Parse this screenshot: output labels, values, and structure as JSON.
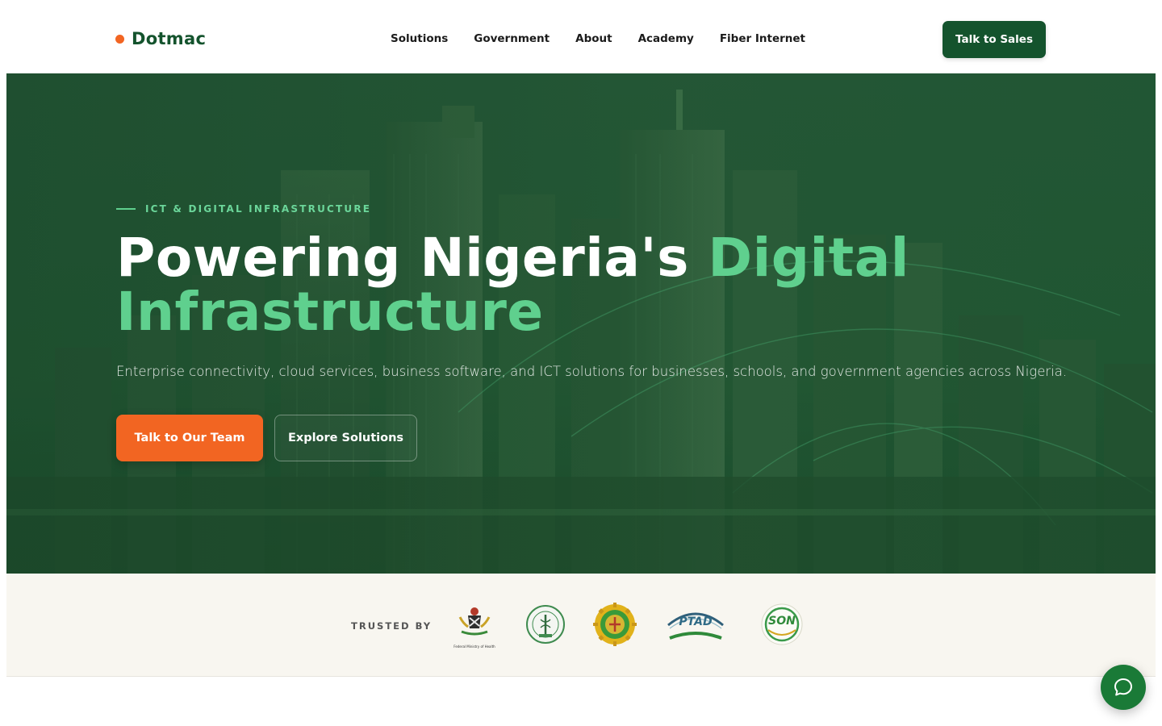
{
  "brand": {
    "name": "Dotmac",
    "dot_color": "#f26522",
    "primary_color": "#14532d"
  },
  "nav": {
    "items": [
      {
        "label": "Solutions"
      },
      {
        "label": "Government"
      },
      {
        "label": "About"
      },
      {
        "label": "Academy"
      },
      {
        "label": "Fiber Internet"
      }
    ],
    "cta_label": "Talk to Sales"
  },
  "hero": {
    "eyebrow": "ICT & DIGITAL INFRASTRUCTURE",
    "headline_part1": "Powering Nigeria's ",
    "headline_accent1": "Digital",
    "headline_accent2": "Infrastructure",
    "subtext": "Enterprise connectivity, cloud services, business software, and ICT solutions for businesses, schools, and government agencies across Nigeria.",
    "primary_button": "Talk to Our Team",
    "secondary_button": "Explore Solutions",
    "accent_color": "#5fd08e"
  },
  "trusted": {
    "label": "TRUSTED BY",
    "logos": [
      {
        "name": "coat-of-arms-logo",
        "caption": "Federal Ministry of Health"
      },
      {
        "name": "medical-council-seal-logo"
      },
      {
        "name": "gear-emblem-logo"
      },
      {
        "name": "ptad-logo",
        "text": "PTAD"
      },
      {
        "name": "son-logo",
        "text": "SON"
      }
    ]
  },
  "chat": {
    "icon": "chat-bubble-icon"
  }
}
